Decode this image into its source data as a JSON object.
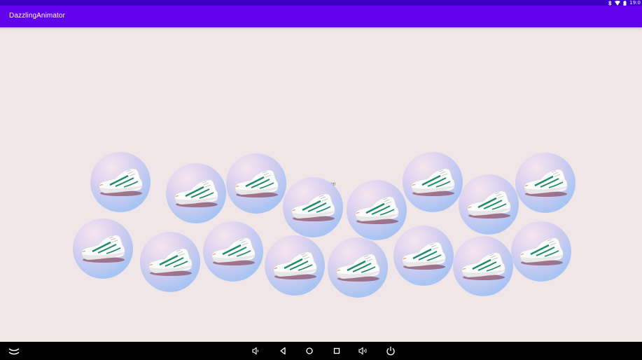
{
  "status_bar": {
    "time": "19:0"
  },
  "app_bar": {
    "title": "DazzlingAnimator"
  },
  "content": {
    "hello_text": "Hello World!",
    "bubble_count": 17
  },
  "nav_bar": {
    "icons": [
      "collapse-icon",
      "volume-down-icon",
      "back-icon",
      "home-icon",
      "recents-icon",
      "volume-up-icon",
      "power-icon"
    ]
  },
  "colors": {
    "status_bar": "#3d00c2",
    "app_bar": "#6200ee",
    "background": "#f0e6e7",
    "nav_bar": "#000000"
  }
}
